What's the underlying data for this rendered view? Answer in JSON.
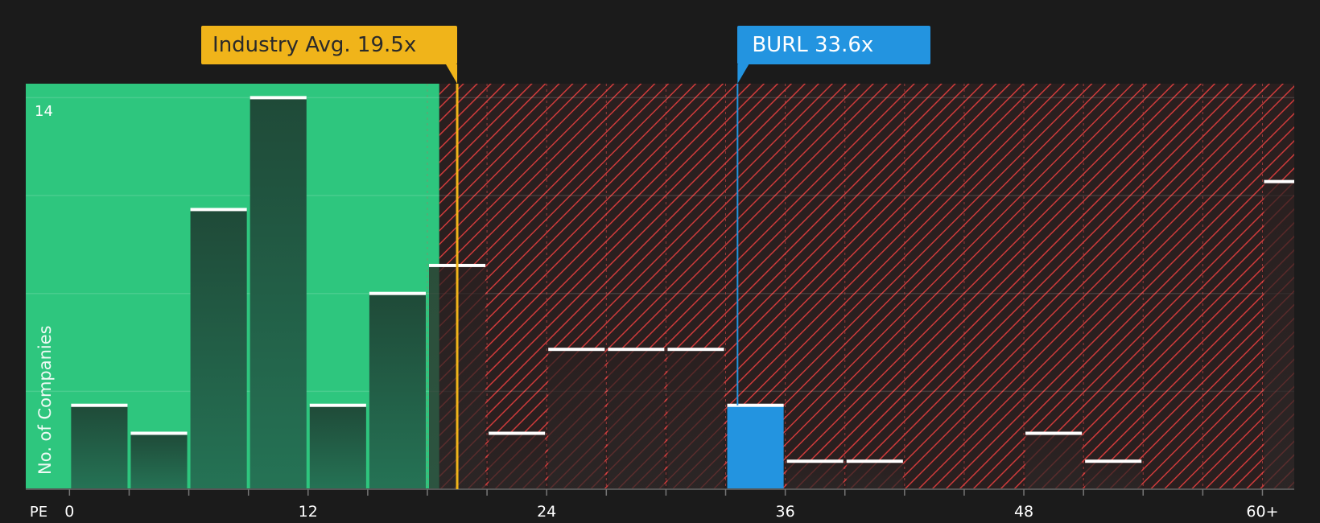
{
  "chart_data": {
    "type": "bar",
    "xlabel": "PE",
    "ylabel": "No. of Companies",
    "x_tick_labels": [
      {
        "value": 0,
        "label": "0"
      },
      {
        "value": 12,
        "label": "12"
      },
      {
        "value": 24,
        "label": "24"
      },
      {
        "value": 36,
        "label": "36"
      },
      {
        "value": 48,
        "label": "48"
      },
      {
        "value": 60,
        "label": "60+"
      }
    ],
    "y_tick_labels": [
      {
        "value": 14,
        "label": "14"
      }
    ],
    "xlim": [
      -2.2,
      61.6
    ],
    "ylim": [
      0,
      14.5
    ],
    "bin_width": 3,
    "bins": [
      {
        "start": 0,
        "count": 3
      },
      {
        "start": 3,
        "count": 2
      },
      {
        "start": 6,
        "count": 10
      },
      {
        "start": 9,
        "count": 14
      },
      {
        "start": 12,
        "count": 3
      },
      {
        "start": 15,
        "count": 7
      },
      {
        "start": 18,
        "count": 8
      },
      {
        "start": 21,
        "count": 2
      },
      {
        "start": 24,
        "count": 5
      },
      {
        "start": 27,
        "count": 5
      },
      {
        "start": 30,
        "count": 5
      },
      {
        "start": 33,
        "count": 3,
        "highlight": true
      },
      {
        "start": 36,
        "count": 1
      },
      {
        "start": 39,
        "count": 1
      },
      {
        "start": 42,
        "count": 0
      },
      {
        "start": 45,
        "count": 0
      },
      {
        "start": 48,
        "count": 2
      },
      {
        "start": 51,
        "count": 1
      },
      {
        "start": 54,
        "count": 0
      },
      {
        "start": 57,
        "count": 0
      },
      {
        "start": 60,
        "count": 11
      }
    ],
    "markers": {
      "industry_avg": {
        "label": "Industry Avg. 19.5x",
        "value": 19.5,
        "color": "#f0b41a"
      },
      "company": {
        "label": "BURL 33.6x",
        "value": 33.6,
        "color": "#2394e0"
      }
    },
    "zones": {
      "fair_zone_end": 18.6,
      "fair_color": "#2ec67e",
      "expensive_color": "#cf3b3b"
    },
    "grid": true
  }
}
